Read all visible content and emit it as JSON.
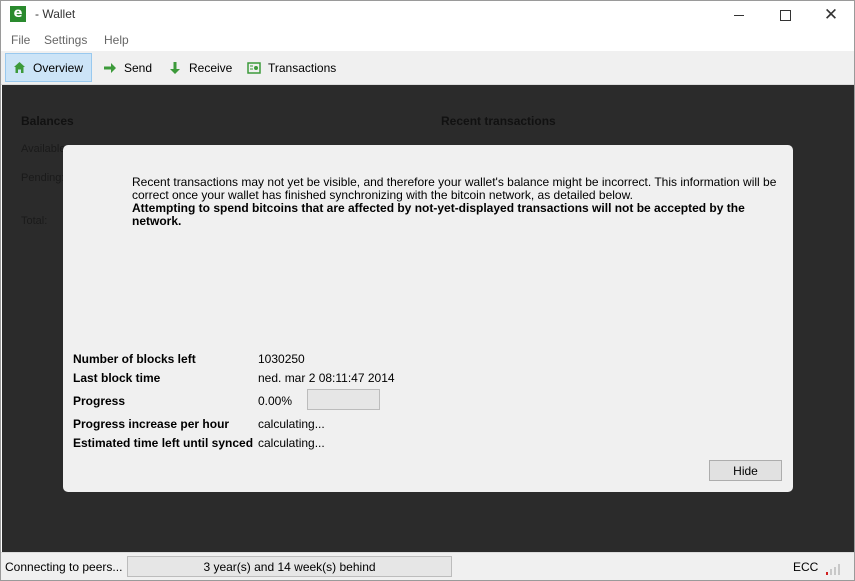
{
  "window": {
    "title": "- Wallet",
    "icon": "wallet-app-icon"
  },
  "menu": {
    "file": "File",
    "settings": "Settings",
    "help": "Help"
  },
  "toolbar": {
    "overview": "Overview",
    "send": "Send",
    "receive": "Receive",
    "transactions": "Transactions"
  },
  "background": {
    "balances": "Balances",
    "available": "Available:",
    "pending": "Pending:",
    "total": "Total:",
    "recent_transactions": "Recent transactions"
  },
  "modal": {
    "message": "Recent transactions may not yet be visible, and therefore your wallet's balance might be incorrect. This information will be correct once your wallet has finished synchronizing with the bitcoin network, as detailed below.",
    "warning": "Attempting to spend bitcoins that are affected by not-yet-displayed transactions will not be accepted by the network.",
    "rows": {
      "blocks_left_label": "Number of blocks left",
      "blocks_left_value": "1030250",
      "last_block_label": "Last block time",
      "last_block_value": "ned. mar 2 08:11:47 2014",
      "progress_label": "Progress",
      "progress_value": "0.00%",
      "progress_fraction": 0,
      "rate_label": "Progress increase per hour",
      "rate_value": "calculating...",
      "eta_label": "Estimated time left until synced",
      "eta_value": "calculating..."
    },
    "hide": "Hide"
  },
  "status": {
    "connection": "Connecting to peers...",
    "behind": "3 year(s) and 14 week(s) behind",
    "ecc": "ECC"
  },
  "colors": {
    "overlay_bg": "#2b2b2b",
    "modal_bg": "#f0f0f0",
    "active_tab": "#cce4f7",
    "icon_green": "#3c9a3a",
    "signal_red": "#d02020"
  }
}
